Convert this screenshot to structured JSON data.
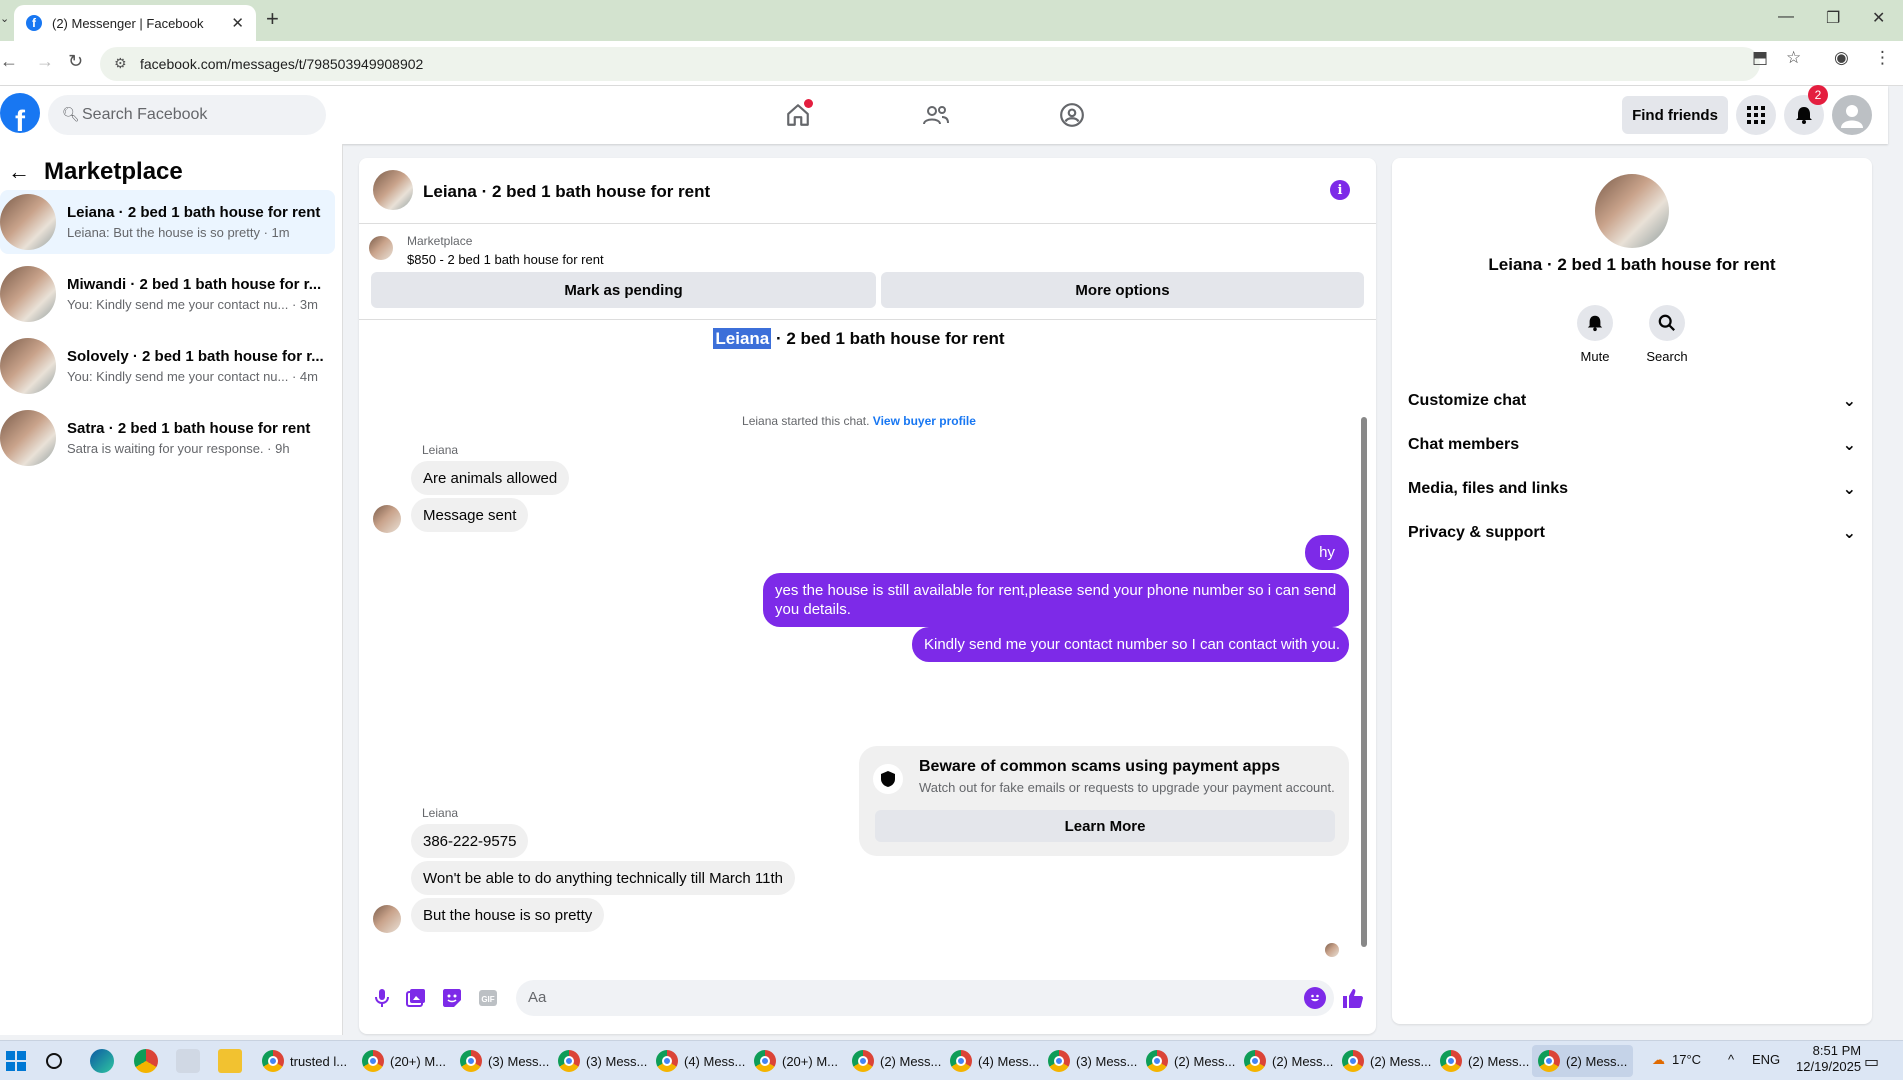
{
  "browser": {
    "tab_title": "(2) Messenger | Facebook",
    "url": "facebook.com/messages/t/7985039499089​02"
  },
  "fb_header": {
    "search_placeholder": "Search Facebook",
    "find_friends": "Find friends",
    "notification_count": "2"
  },
  "sidebar": {
    "title": "Marketplace",
    "conversations": [
      {
        "name": "Leiana · 2 bed 1 bath house for rent",
        "preview": "Leiana: But the house is so pretty · 1m"
      },
      {
        "name": "Miwandi · 2 bed 1 bath house for r...",
        "preview": "You: Kindly send me your contact nu... · 3m"
      },
      {
        "name": "Solovely · 2 bed 1 bath house for r...",
        "preview": "You: Kindly send me your contact nu... · 4m"
      },
      {
        "name": "Satra · 2 bed 1 bath house for rent",
        "preview": "Satra is waiting for your response. · 9h"
      }
    ]
  },
  "chat": {
    "title": "Leiana · 2 bed 1 bath house for rent",
    "marketplace_label": "Marketplace",
    "listing": "$850 - 2 bed 1 bath house for rent",
    "mark_pending": "Mark as pending",
    "more_options": "More options",
    "conv_title_highlight": "Leiana",
    "conv_title_rest": " · 2 bed 1 bath house for rent",
    "started_text": "Leiana started this chat. ",
    "view_buyer": "View buyer profile",
    "sender1": "Leiana",
    "msg_in_1": "Are animals allowed",
    "msg_in_2": "Message sent",
    "msg_out_1": "hy",
    "msg_out_2": "yes the house is still available for rent,please send your phone number so i can send you details.",
    "msg_out_3": "Kindly send me your contact number so I can contact with you.",
    "scam_title": "Beware of common scams using payment apps",
    "scam_desc": "Watch out for fake emails or requests to upgrade your payment account.",
    "learn_more": "Learn More",
    "sender2": "Leiana",
    "msg_in_3": "386-222-9575",
    "msg_in_4": "Won't be able to do anything technically till March 11th",
    "msg_in_5": "But the house is so pretty",
    "composer_placeholder": "Aa"
  },
  "right_panel": {
    "name": "Leiana · 2 bed 1 bath house for rent",
    "mute": "Mute",
    "search": "Search",
    "sections": [
      "Customize chat",
      "Chat members",
      "Media, files and links",
      "Privacy & support"
    ]
  },
  "taskbar": {
    "items": [
      "trusted l...",
      "(20+) M...",
      "(3) Mess...",
      "(3) Mess...",
      "(4) Mess...",
      "(20+) M...",
      "(2) Mess...",
      "(4) Mess...",
      "(3) Mess...",
      "(2) Mess...",
      "(2) Mess...",
      "(2) Mess...",
      "(2) Mess...",
      "(2) Mess..."
    ],
    "weather": "17°C",
    "lang": "ENG",
    "time": "8:51 PM",
    "date": "12/19/2025"
  },
  "colors": {
    "accent": "#7d2ae8",
    "fb_blue": "#1877f2",
    "selected_bg": "#ebf5ff"
  }
}
